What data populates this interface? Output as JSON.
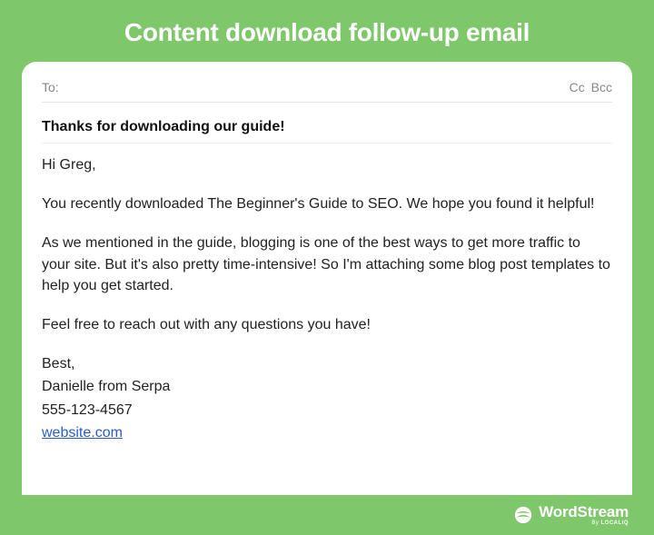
{
  "header": {
    "title": "Content download follow-up email"
  },
  "compose": {
    "to_label": "To:",
    "cc_label": "Cc",
    "bcc_label": "Bcc",
    "subject": "Thanks for downloading our guide!"
  },
  "body": {
    "greeting": "Hi Greg,",
    "p1": "You recently downloaded The Beginner's Guide to SEO. We hope you found it helpful!",
    "p2": "As we mentioned in the guide, blogging is one of the best ways to get more traffic to your site. But it's also pretty time-intensive! So I'm attaching some blog post templates to help you get started.",
    "p3": "Feel free to reach out with any questions you have!"
  },
  "signature": {
    "closing": "Best,",
    "name": "Danielle from Serpa",
    "phone": "555-123-4567",
    "website": "website.com"
  },
  "footer": {
    "brand": "WordStream",
    "by_prefix": "By ",
    "by_brand": "LOCALiQ"
  }
}
